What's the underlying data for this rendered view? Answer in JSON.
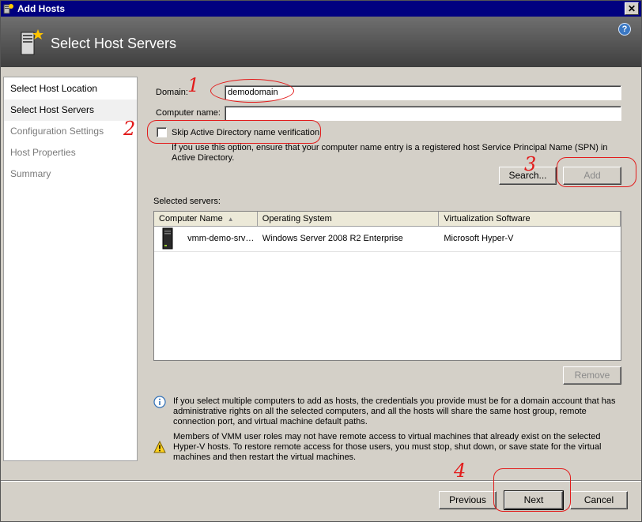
{
  "window": {
    "title": "Add Hosts",
    "close_glyph": "✕"
  },
  "header": {
    "heading": "Select Host Servers",
    "help_glyph": "?",
    "icon": "server-wizard-icon"
  },
  "nav": {
    "items": [
      {
        "label": "Select Host Location",
        "state": "enabled"
      },
      {
        "label": "Select Host Servers",
        "state": "selected"
      },
      {
        "label": "Configuration Settings",
        "state": "disabled"
      },
      {
        "label": "Host Properties",
        "state": "disabled"
      },
      {
        "label": "Summary",
        "state": "disabled"
      }
    ]
  },
  "form": {
    "domain_label": "Domain:",
    "domain_value": "demodomain",
    "computer_label": "Computer name:",
    "computer_value": "",
    "skip_ad_label": "Skip Active Directory name verification",
    "skip_ad_checked": false,
    "skip_ad_note": "If you use this option, ensure that your computer name entry is a registered host Service Principal Name (SPN) in Active Directory.",
    "search_label": "Search...",
    "add_label": "Add"
  },
  "servers": {
    "label": "Selected servers:",
    "columns": [
      "Computer Name",
      "Operating System",
      "Virtualization Software"
    ],
    "sort_glyph": "▲",
    "rows": [
      {
        "computer": "vmm-demo-srv…",
        "os": "Windows Server 2008 R2 Enterprise",
        "virt": "Microsoft Hyper-V"
      }
    ],
    "remove_label": "Remove"
  },
  "info": {
    "credentials_text": "If you select multiple computers to add as hosts, the credentials you provide must be for a domain account that has administrative rights on all the selected computers, and all the hosts will share the same host group, remote connection port, and virtual machine default paths.",
    "warning_text": "Members of VMM user roles may not have remote access to virtual machines that already exist on the selected Hyper-V hosts. To restore remote access for those users, you must stop, shut down, or save state for the virtual machines and then restart the virtual machines.",
    "info_icon": "info-icon",
    "warning_icon": "warning-icon"
  },
  "footer": {
    "previous_label": "Previous",
    "next_label": "Next",
    "cancel_label": "Cancel"
  },
  "annotations": {
    "n1": "1",
    "n2": "2",
    "n3": "3",
    "n4": "4",
    "color": "#e21b1b"
  }
}
